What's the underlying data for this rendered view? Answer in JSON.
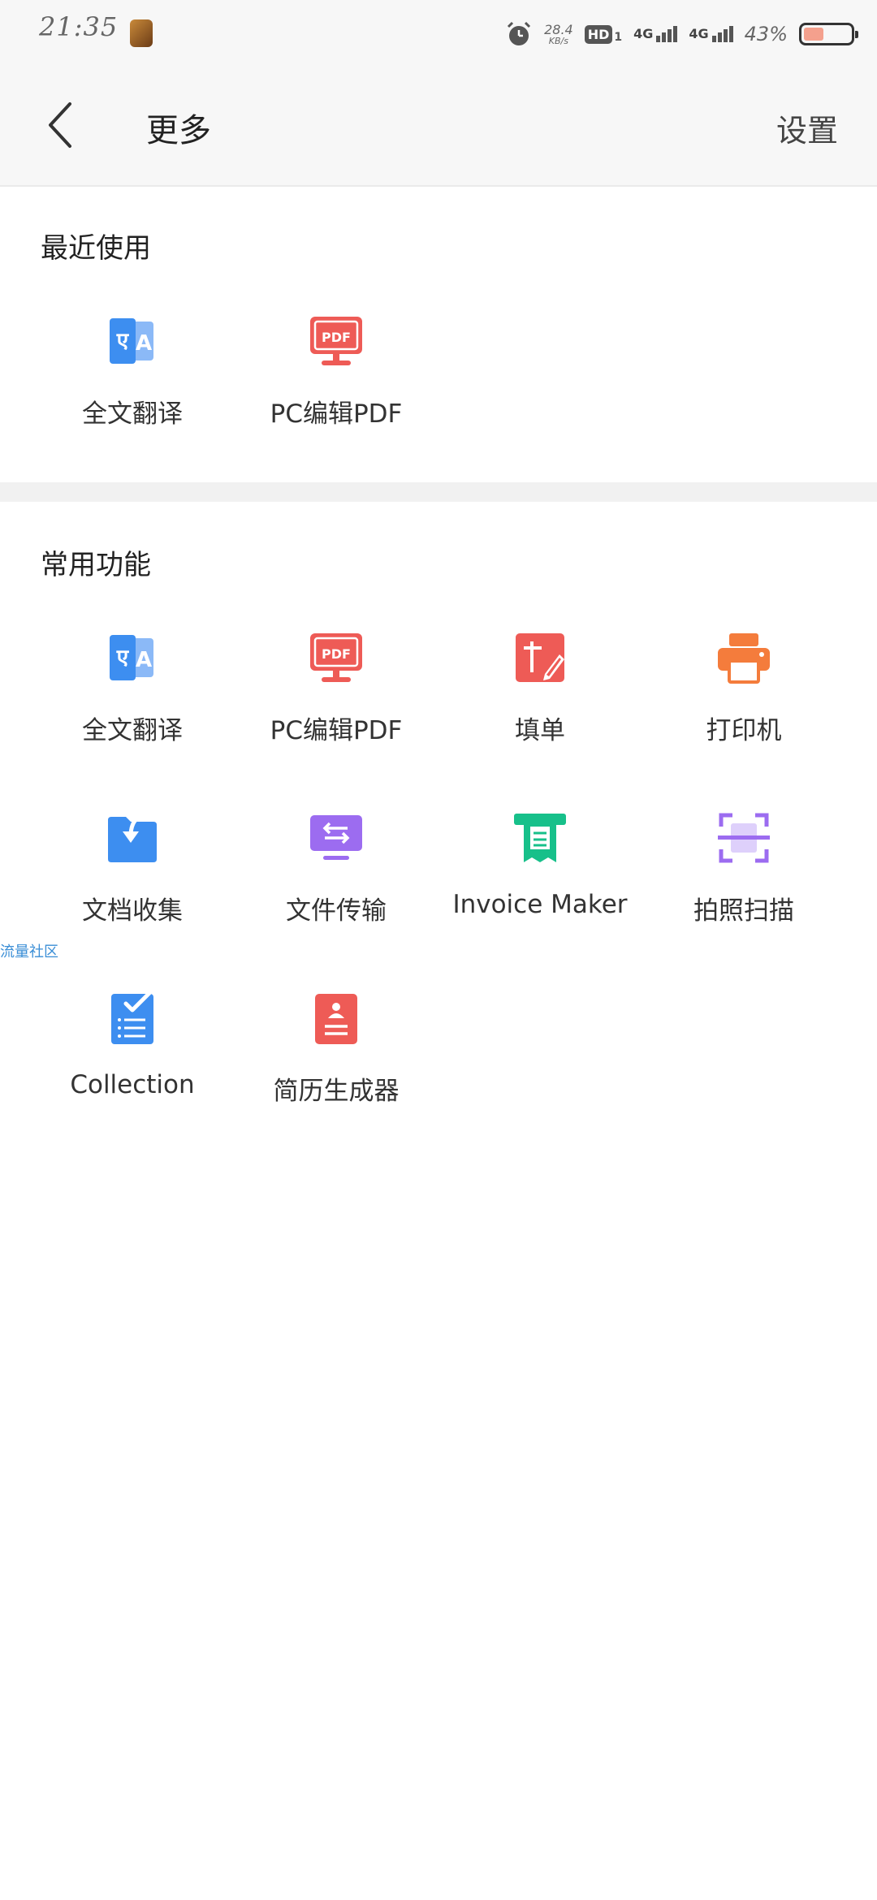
{
  "status_bar": {
    "time": "21:35",
    "net_speed": "28.4",
    "net_speed_unit": "KB/s",
    "hd_label": "HD",
    "hd_sub": "1",
    "sim1_label": "4G",
    "sim2_label": "4G",
    "battery_percent": "43%",
    "battery_level": 0.43,
    "battery_color": "#f4a08d"
  },
  "header": {
    "title": "更多",
    "settings": "设置"
  },
  "recent": {
    "title": "最近使用",
    "items": [
      {
        "label": "全文翻译",
        "icon": "translate-icon"
      },
      {
        "label": "PC编辑PDF",
        "icon": "pc-pdf-icon"
      }
    ]
  },
  "common": {
    "title": "常用功能",
    "items": [
      {
        "label": "全文翻译",
        "icon": "translate-icon"
      },
      {
        "label": "PC编辑PDF",
        "icon": "pc-pdf-icon"
      },
      {
        "label": "填单",
        "icon": "fill-form-icon"
      },
      {
        "label": "打印机",
        "icon": "printer-icon"
      },
      {
        "label": "文档收集",
        "icon": "document-collect-icon"
      },
      {
        "label": "文件传输",
        "icon": "file-transfer-icon"
      },
      {
        "label": "Invoice Maker",
        "icon": "invoice-icon"
      },
      {
        "label": "拍照扫描",
        "icon": "scan-icon"
      },
      {
        "label": "Collection",
        "icon": "collection-icon"
      },
      {
        "label": "简历生成器",
        "icon": "resume-icon"
      }
    ]
  },
  "watermark": "流量社区",
  "colors": {
    "blue": "#3d8ef0",
    "red": "#ee5b56",
    "orange": "#f47c3c",
    "purple": "#9c6cf0",
    "green": "#17c08a"
  }
}
